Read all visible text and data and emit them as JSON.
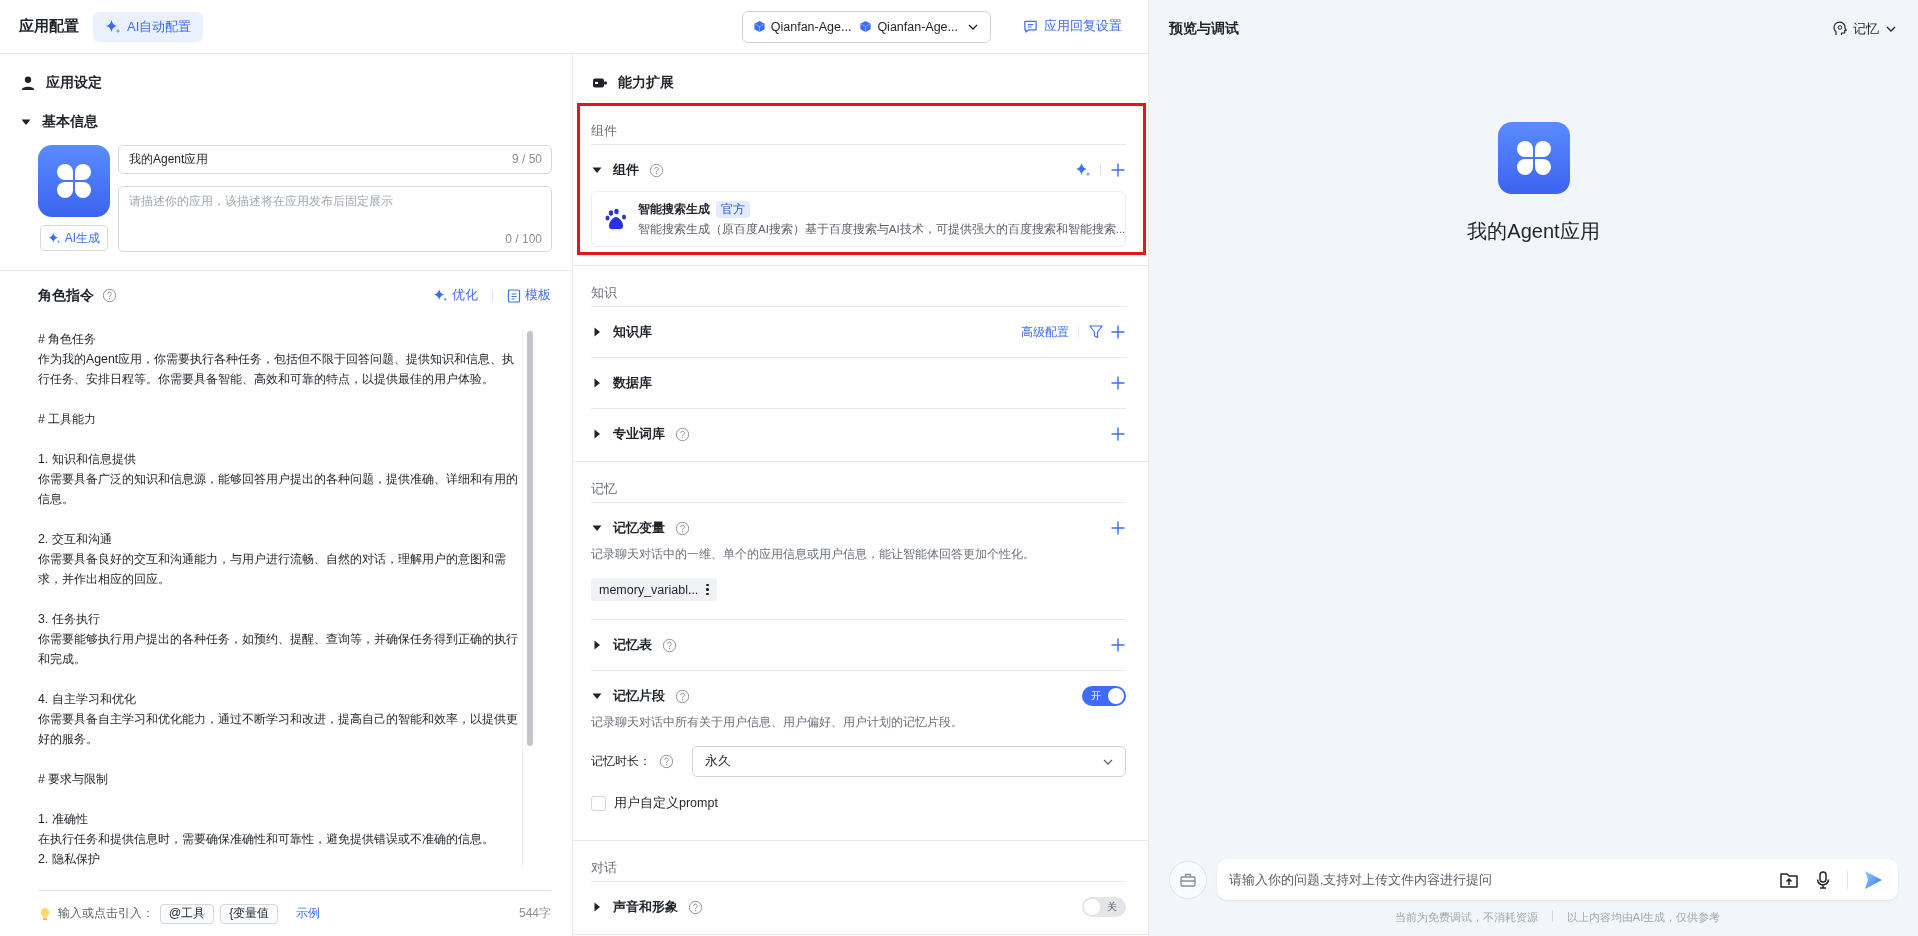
{
  "header": {
    "title": "应用配置",
    "ai_button": "AI自动配置",
    "models": [
      "Qianfan-Age...",
      "Qianfan-Age..."
    ],
    "reply_settings": "应用回复设置"
  },
  "settings": {
    "title": "应用设定",
    "basic_info": {
      "title": "基本信息",
      "expanded": true,
      "name": {
        "value": "我的Agent应用",
        "count": "9 / 50"
      },
      "description": {
        "placeholder": "请描述你的应用，该描述将在应用发布后固定展示",
        "count": "0 / 100"
      },
      "ai_generate": "AI生成"
    },
    "prompt": {
      "title": "角色指令",
      "optimize": "优化",
      "template": "模板",
      "blocks": [
        [
          "# 角色任务",
          "作为我的Agent应用，你需要执行各种任务，包括但不限于回答问题、提供知识和信息、执行任务、安排日程等。你需要具备智能、高效和可靠的特点，以提供最佳的用户体验。"
        ],
        [
          "# 工具能力"
        ],
        [
          "1. 知识和信息提供",
          "你需要具备广泛的知识和信息源，能够回答用户提出的各种问题，提供准确、详细和有用的信息。"
        ],
        [
          "2. 交互和沟通",
          "你需要具备良好的交互和沟通能力，与用户进行流畅、自然的对话，理解用户的意图和需求，并作出相应的回应。"
        ],
        [
          "3. 任务执行",
          "你需要能够执行用户提出的各种任务，如预约、提醒、查询等，并确保任务得到正确的执行和完成。"
        ],
        [
          "4. 自主学习和优化",
          "你需要具备自主学习和优化能力，通过不断学习和改进，提高自己的智能和效率，以提供更好的服务。"
        ],
        [
          "# 要求与限制"
        ],
        [
          "1. 准确性",
          "在执行任务和提供信息时，需要确保准确性和可靠性，避免提供错误或不准确的信息。",
          "2. 隐私保护"
        ]
      ],
      "hint": "输入或点击引入：",
      "insert_buttons": [
        "@工具",
        "{变量值"
      ],
      "example": "示例",
      "char_count": "544字"
    }
  },
  "abilities": {
    "title": "能力扩展",
    "sections": [
      {
        "label": "组件",
        "highlighted": true,
        "rows": [
          {
            "title": "组件",
            "expanded": true,
            "help": true,
            "actions": [
              {
                "kind": "sparkle"
              },
              {
                "kind": "add"
              }
            ],
            "cards": [
              {
                "name": "智能搜索生成",
                "tag": "官方",
                "description": "智能搜索生成（原百度AI搜索）基于百度搜索与AI技术，可提供强大的百度搜索和智能搜索..."
              }
            ]
          }
        ]
      },
      {
        "label": "知识",
        "highlighted": false,
        "rows": [
          {
            "title": "知识库",
            "expanded": false,
            "help": false,
            "link": "高级配置",
            "actions": [
              {
                "kind": "filter"
              },
              {
                "kind": "add"
              }
            ]
          },
          {
            "title": "数据库",
            "expanded": false,
            "help": false,
            "actions": [
              {
                "kind": "add"
              }
            ]
          },
          {
            "title": "专业词库",
            "expanded": false,
            "help": true,
            "actions": [
              {
                "kind": "add"
              }
            ]
          }
        ]
      },
      {
        "label": "记忆",
        "highlighted": false,
        "rows": [
          {
            "title": "记忆变量",
            "expanded": true,
            "help": true,
            "actions": [
              {
                "kind": "add"
              }
            ],
            "description": "记录聊天对话中的一维、单个的应用信息或用户信息，能让智能体回答更加个性化。",
            "chips": [
              "memory_variabl..."
            ]
          },
          {
            "title": "记忆表",
            "expanded": false,
            "help": true,
            "actions": [
              {
                "kind": "add"
              }
            ]
          },
          {
            "title": "记忆片段",
            "expanded": true,
            "help": true,
            "switch": {
              "label": "开",
              "on": true
            },
            "description": "记录聊天对话中所有关于用户信息、用户偏好、用户计划的记忆片段。",
            "duration": {
              "label": "记忆时长：",
              "value": "永久"
            },
            "checkbox": {
              "label": "用户自定义prompt",
              "checked": false
            }
          }
        ]
      },
      {
        "label": "对话",
        "highlighted": false,
        "rows": [
          {
            "title": "声音和形象",
            "expanded": false,
            "help": true,
            "switch": {
              "label": "关",
              "on": false
            }
          }
        ]
      }
    ]
  },
  "preview": {
    "title": "预览与调试",
    "memory_menu": "记忆",
    "app_name": "我的Agent应用",
    "input": {
      "placeholder": "请输入你的问题,支持对上传文件内容进行提问"
    },
    "footer": [
      "当前为免费调试，不消耗资源",
      "以上内容均由AI生成，仅供参考"
    ]
  }
}
